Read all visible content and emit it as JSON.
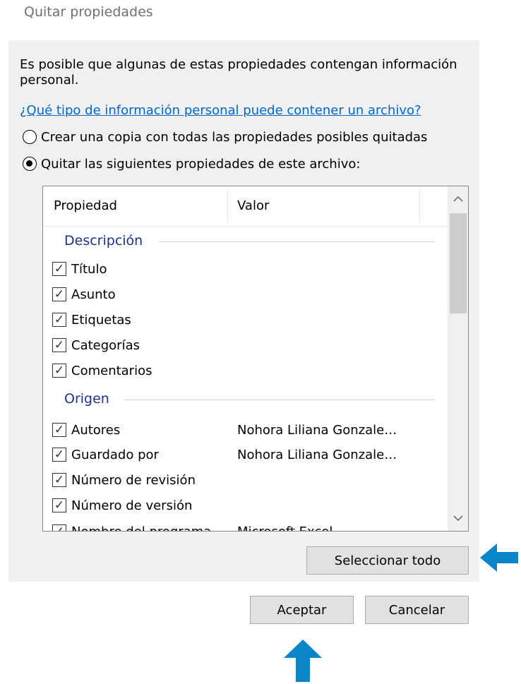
{
  "dialog": {
    "title": "Quitar propiedades",
    "intro": "Es posible que algunas de estas propiedades contengan información personal.",
    "help_link": "¿Qué tipo de información personal puede contener un archivo?"
  },
  "options": {
    "copy_label": "Crear una copia con todas las propiedades posibles quitadas",
    "remove_label": "Quitar las siguientes propiedades de este archivo:",
    "selected": "remove"
  },
  "list": {
    "columns": [
      "Propiedad",
      "Valor"
    ],
    "groups": [
      {
        "name": "Descripción",
        "items": [
          {
            "label": "Título",
            "value": "",
            "checked": true
          },
          {
            "label": "Asunto",
            "value": "",
            "checked": true
          },
          {
            "label": "Etiquetas",
            "value": "",
            "checked": true
          },
          {
            "label": "Categorías",
            "value": "",
            "checked": true
          },
          {
            "label": "Comentarios",
            "value": "",
            "checked": true
          }
        ]
      },
      {
        "name": "Origen",
        "items": [
          {
            "label": "Autores",
            "value": "Nohora Liliana Gonzale…",
            "checked": true
          },
          {
            "label": "Guardado por",
            "value": "Nohora Liliana Gonzale…",
            "checked": true
          },
          {
            "label": "Número de revisión",
            "value": "",
            "checked": true
          },
          {
            "label": "Número de versión",
            "value": "",
            "checked": true
          },
          {
            "label": "Nombre del programa",
            "value": "Microsoft Excel",
            "checked": true
          }
        ]
      }
    ]
  },
  "buttons": {
    "select_all": "Seleccionar todo",
    "accept": "Aceptar",
    "cancel": "Cancelar"
  },
  "colors": {
    "annotation_arrow": "#0a85c9",
    "link": "#0066cc",
    "group_header": "#1e3287"
  }
}
